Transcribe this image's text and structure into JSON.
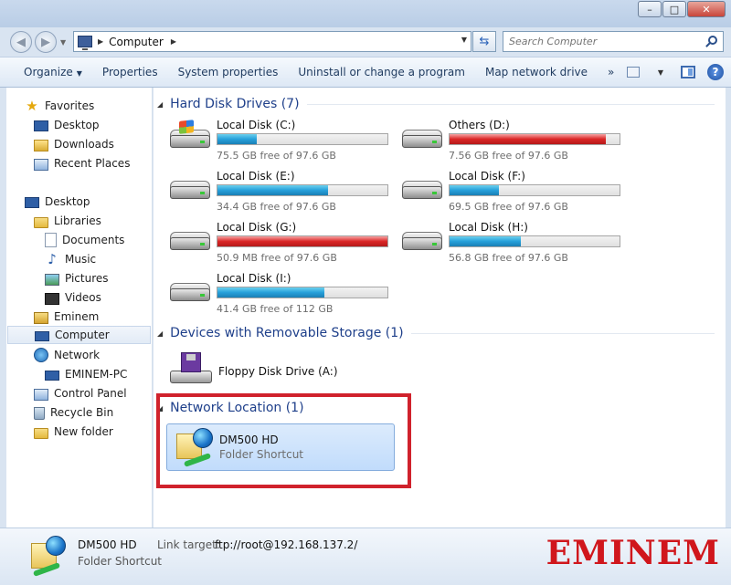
{
  "window": {
    "minimize": "–",
    "maximize": "□",
    "close": "✕"
  },
  "address": {
    "path": "Computer",
    "search_placeholder": "Search Computer"
  },
  "toolbar": {
    "organize": "Organize",
    "properties": "Properties",
    "system_properties": "System properties",
    "uninstall": "Uninstall or change a program",
    "map_drive": "Map network drive",
    "more": "»",
    "help": "?"
  },
  "sidebar": {
    "favorites": "Favorites",
    "desktop_fav": "Desktop",
    "downloads": "Downloads",
    "recent": "Recent Places",
    "desktop": "Desktop",
    "libraries": "Libraries",
    "documents": "Documents",
    "music": "Music",
    "pictures": "Pictures",
    "videos": "Videos",
    "user": "Eminem",
    "computer": "Computer",
    "network": "Network",
    "pc": "EMINEM-PC",
    "control_panel": "Control Panel",
    "recycle_bin": "Recycle Bin",
    "new_folder": "New folder"
  },
  "groups": {
    "hdd": "Hard Disk Drives (7)",
    "removable": "Devices with Removable Storage (1)",
    "network": "Network Location (1)"
  },
  "drives": [
    {
      "name": "Local Disk (C:)",
      "free": "75.5 GB free of 97.6 GB",
      "used_fraction": 0.23,
      "critical": false
    },
    {
      "name": "Others (D:)",
      "free": "7.56 GB free of 97.6 GB",
      "used_fraction": 0.92,
      "critical": true
    },
    {
      "name": "Local Disk (E:)",
      "free": "34.4 GB free of 97.6 GB",
      "used_fraction": 0.65,
      "critical": false
    },
    {
      "name": "Local Disk (F:)",
      "free": "69.5 GB free of 97.6 GB",
      "used_fraction": 0.29,
      "critical": false
    },
    {
      "name": "Local Disk (G:)",
      "free": "50.9 MB free of 97.6 GB",
      "used_fraction": 1.0,
      "critical": true
    },
    {
      "name": "Local Disk (H:)",
      "free": "56.8 GB free of 97.6 GB",
      "used_fraction": 0.42,
      "critical": false
    },
    {
      "name": "Local Disk (I:)",
      "free": "41.4 GB free of 112 GB",
      "used_fraction": 0.63,
      "critical": false
    }
  ],
  "floppy": {
    "name": "Floppy Disk Drive (A:)"
  },
  "network_location": {
    "name": "DM500 HD",
    "type": "Folder Shortcut"
  },
  "details": {
    "name": "DM500 HD",
    "type": "Folder Shortcut",
    "link_label": "Link target:",
    "link_value": "ftp://root@192.168.137.2/"
  },
  "watermark": "EMINEM",
  "colors": {
    "bar_normal": "#26a0da",
    "bar_critical": "#da2626",
    "highlight": "#d0222c",
    "watermark": "#d0161c"
  }
}
